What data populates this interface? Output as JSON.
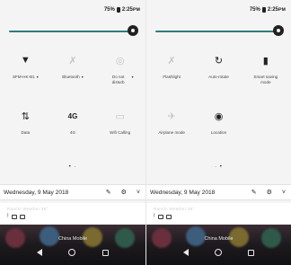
{
  "left": {
    "status": {
      "battery": "75%",
      "time": "2:25ᴘᴍ"
    },
    "brightness_level": 1.0,
    "tiles": [
      {
        "label": "SFM-HK-B1",
        "icon": "wifi-icon",
        "glyph": "▼",
        "dim": false,
        "has_caret": true
      },
      {
        "label": "Bluetooth",
        "icon": "bluetooth-off-icon",
        "glyph": "✗",
        "dim": true,
        "has_caret": true
      },
      {
        "label": "Do not disturb",
        "icon": "do-not-disturb-icon",
        "glyph": "◎",
        "dim": true,
        "has_caret": true
      },
      {
        "label": "Data",
        "icon": "mobile-data-icon",
        "glyph": "⇅",
        "dim": false,
        "has_caret": false
      },
      {
        "label": "4G",
        "icon": "4g-icon",
        "glyph": "4G",
        "dim": false,
        "has_caret": false
      },
      {
        "label": "Wifi Calling",
        "icon": "wifi-calling-icon",
        "glyph": "▭",
        "dim": true,
        "has_caret": false
      }
    ],
    "page_dots": "• ·",
    "date": "Wednesday, 9 May 2018",
    "notification_text": "Ranchi Weather 38°",
    "carrier": "China Mobile"
  },
  "right": {
    "status": {
      "battery": "75%",
      "time": "2:25ᴘᴍ"
    },
    "brightness_level": 1.0,
    "tiles": [
      {
        "label": "Flashlight",
        "icon": "flashlight-icon",
        "glyph": "✗",
        "dim": true,
        "has_caret": false
      },
      {
        "label": "Auto-rotate",
        "icon": "auto-rotate-icon",
        "glyph": "↻",
        "dim": false,
        "has_caret": false
      },
      {
        "label": "Smart saving mode",
        "icon": "battery-icon",
        "glyph": "▮",
        "dim": false,
        "has_caret": false
      },
      {
        "label": "Airplane mode",
        "icon": "airplane-icon",
        "glyph": "✈",
        "dim": true,
        "has_caret": false
      },
      {
        "label": "Location",
        "icon": "location-icon",
        "glyph": "◉",
        "dim": false,
        "has_caret": false
      }
    ],
    "page_dots": "· •",
    "date": "Wednesday, 9 May 2018",
    "notification_text": "Ranchi Weather 38°",
    "carrier": "China Mobile"
  },
  "icons": {
    "edit": "✎",
    "settings": "⚙",
    "expand": "˅"
  },
  "colors": {
    "brightness_track": "#2b8a8a",
    "panel_bg": "#f4f4f4",
    "home_bg": "#1d1a1e"
  }
}
